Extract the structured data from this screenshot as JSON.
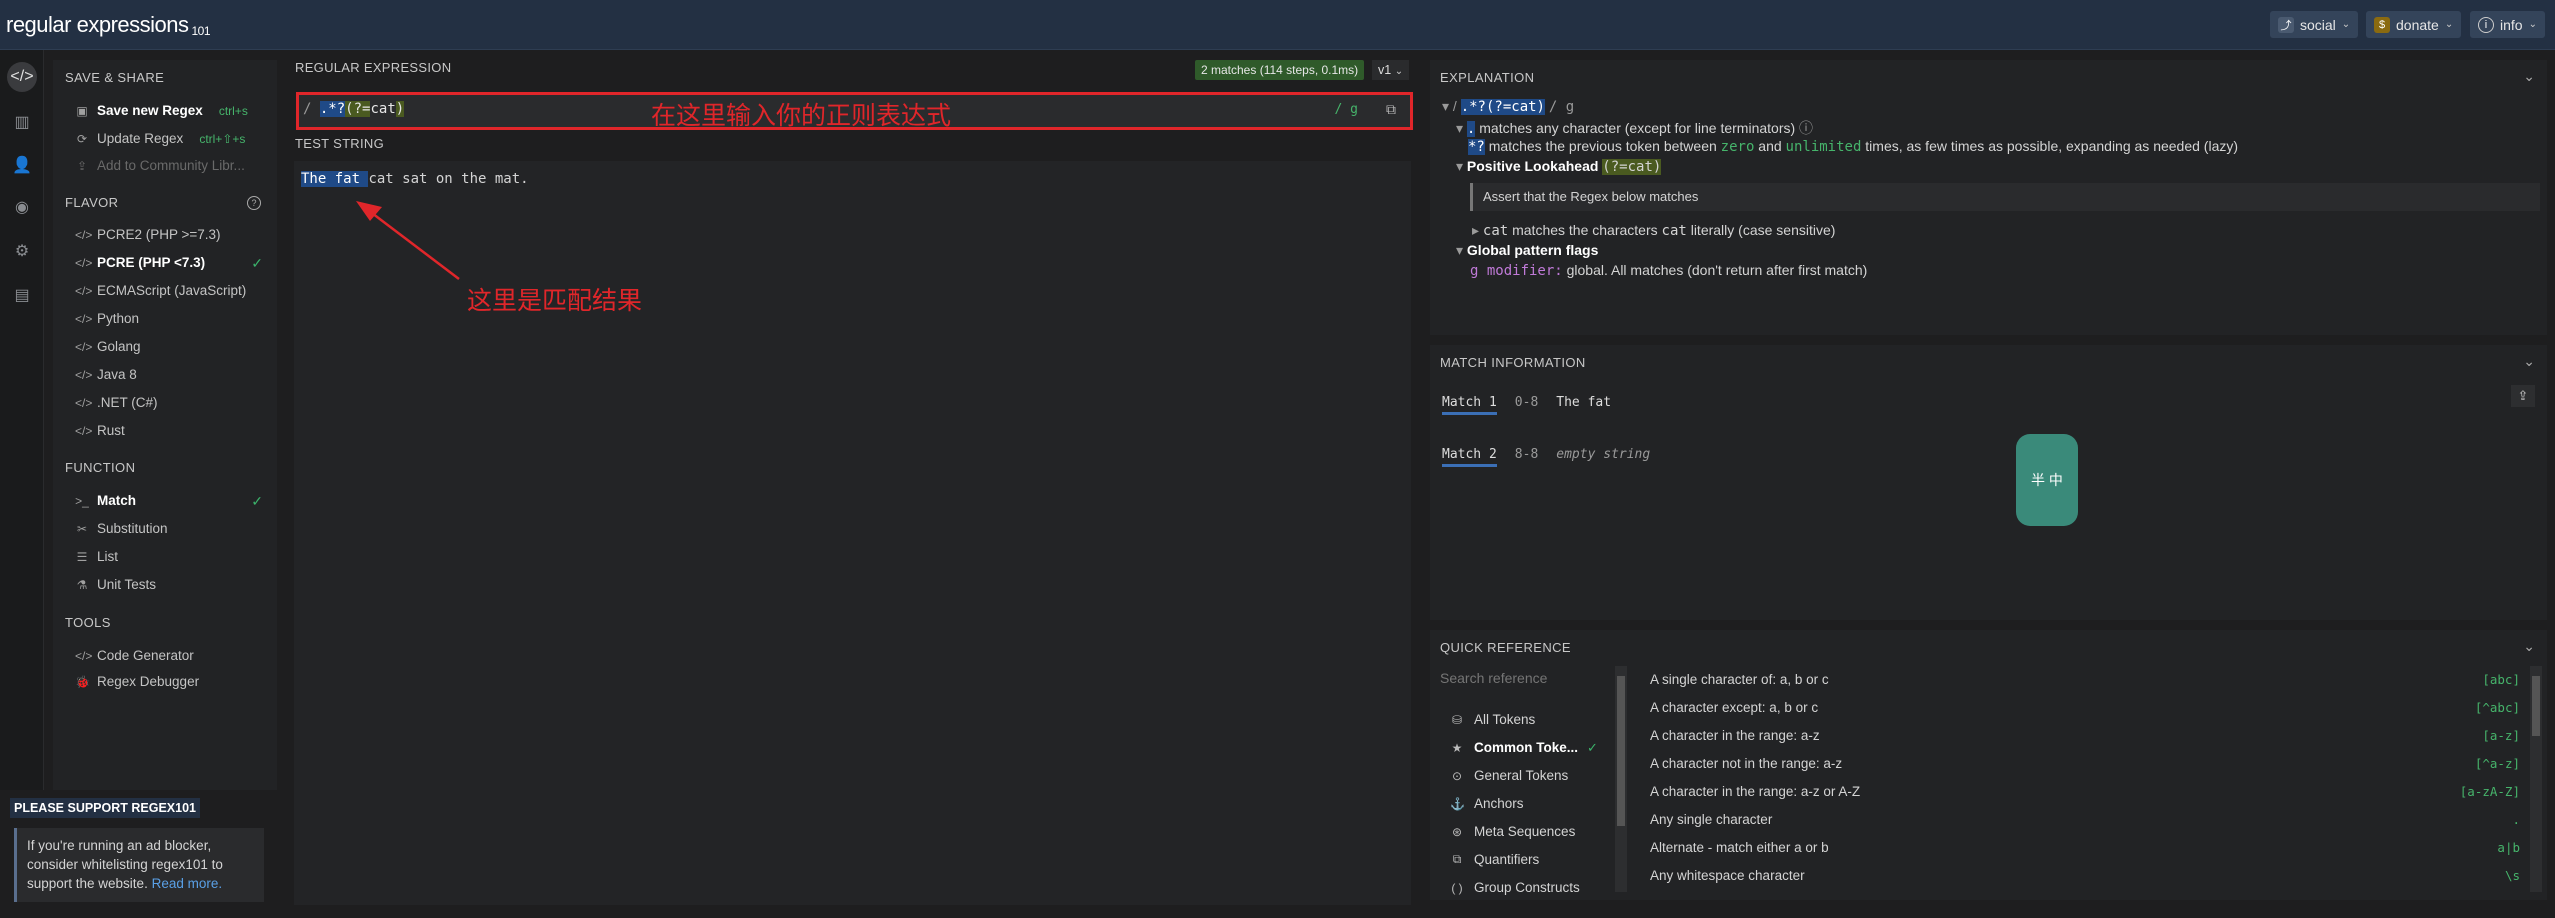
{
  "topbar": {
    "logo": "regular expressions",
    "logo_sub": "101",
    "social": "social",
    "donate": "donate",
    "info": "info"
  },
  "sidebar": {
    "save_share": "SAVE & SHARE",
    "save_new": "Save new Regex",
    "save_new_kbd": "ctrl+s",
    "update": "Update Regex",
    "update_kbd": "ctrl+⇧+s",
    "add_community": "Add to Community Libr...",
    "flavor": "FLAVOR",
    "flavors": [
      "PCRE2 (PHP >=7.3)",
      "PCRE (PHP <7.3)",
      "ECMAScript (JavaScript)",
      "Python",
      "Golang",
      "Java 8",
      ".NET (C#)",
      "Rust"
    ],
    "function": "FUNCTION",
    "functions": [
      "Match",
      "Substitution",
      "List",
      "Unit Tests"
    ],
    "tools": "TOOLS",
    "tool_items": [
      "Code Generator",
      "Regex Debugger"
    ]
  },
  "support": {
    "title": "PLEASE SUPPORT REGEX101",
    "text": "If you're running an ad blocker, consider whitelisting regex101 to support the website.",
    "link": "Read more."
  },
  "regex": {
    "label": "REGULAR EXPRESSION",
    "matches_badge": "2 matches (114 steps, 0.1ms)",
    "version": "v1",
    "delim_open": "/",
    "part1": ".*?",
    "part2": "(?=",
    "part3": "cat",
    "part4": ")",
    "flags": "/ g",
    "annotation": "在这里输入你的正则表达式"
  },
  "test": {
    "label": "TEST STRING",
    "match_text": "The fat ",
    "rest_text": "cat sat on the mat.",
    "annotation": "这里是匹配结果"
  },
  "explanation": {
    "title": "EXPLANATION",
    "line1_regex": ".*?(?=cat)",
    "line1_flags": "/ g",
    "line2": "matches any character (except for line terminators)",
    "line3_a": "matches the previous token between",
    "line3_zero": "zero",
    "line3_and": "and",
    "line3_unl": "unlimited",
    "line3_b": "times, as few times as possible, expanding as needed (lazy)",
    "lookahead": "Positive Lookahead",
    "lookahead_code": "(?=cat)",
    "assert": "Assert that the Regex below matches",
    "cat_line_a": "matches the characters",
    "cat_line_b": "literally (case sensitive)",
    "global_flags": "Global pattern flags",
    "gmod": "g modifier:",
    "gmod_desc": "global. All matches (don't return after first match)"
  },
  "matchinfo": {
    "title": "MATCH INFORMATION",
    "rows": [
      {
        "label": "Match 1",
        "range": "0-8",
        "value": "The fat "
      },
      {
        "label": "Match 2",
        "range": "8-8",
        "value": "empty string"
      }
    ]
  },
  "quickref": {
    "title": "QUICK REFERENCE",
    "search_placeholder": "Search reference",
    "categories": [
      "All Tokens",
      "Common Toke...",
      "General Tokens",
      "Anchors",
      "Meta Sequences",
      "Quantifiers",
      "Group Constructs"
    ],
    "rows": [
      {
        "desc": "A single character of: a, b or c",
        "code": "[abc]"
      },
      {
        "desc": "A character except: a, b or c",
        "code": "[^abc]"
      },
      {
        "desc": "A character in the range: a-z",
        "code": "[a-z]"
      },
      {
        "desc": "A character not in the range: a-z",
        "code": "[^a-z]"
      },
      {
        "desc": "A character in the range: a-z or A-Z",
        "code": "[a-zA-Z]"
      },
      {
        "desc": "Any single character",
        "code": "."
      },
      {
        "desc": "Alternate - match either a or b",
        "code": "a|b"
      },
      {
        "desc": "Any whitespace character",
        "code": "\\s"
      }
    ]
  },
  "widget": {
    "text": "半 中"
  },
  "colors": {
    "accent": "#46b46b",
    "highlight": "#1f4a87",
    "annotation": "#e0262a"
  }
}
